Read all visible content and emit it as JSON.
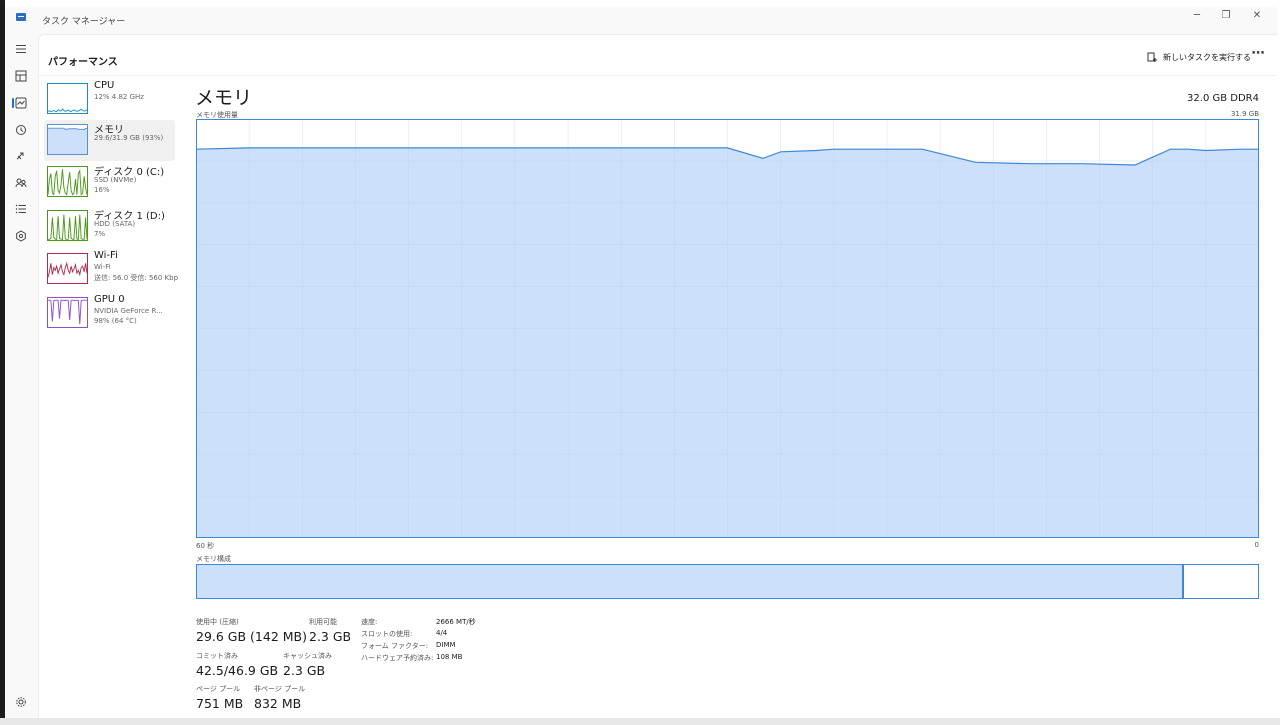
{
  "window": {
    "title": "タスク マネージャー",
    "controls": [
      "minimize-icon",
      "restore-icon",
      "close-icon"
    ]
  },
  "header": {
    "page_title": "パフォーマンス",
    "new_task_label": "新しいタスクを実行する",
    "more_label": "⋯"
  },
  "nav": {
    "items": [
      "hamburger-icon",
      "processes-icon",
      "performance-icon",
      "app-history-icon",
      "startup-apps-icon",
      "users-icon",
      "details-icon",
      "services-icon"
    ],
    "settings": "gear-icon",
    "active": "performance-icon"
  },
  "sidebar": {
    "items": [
      {
        "name": "CPU",
        "sub1": "12% 4.82 GHz",
        "sub2": "",
        "sub3": "",
        "color": "#1c8fbb",
        "fill": "#ffffff",
        "values": [
          6,
          8,
          5,
          7,
          9,
          6,
          5,
          12,
          8,
          7,
          14,
          9,
          6,
          8,
          10,
          7,
          5,
          9,
          11,
          8,
          6,
          7,
          10,
          14,
          9,
          7,
          8,
          12
        ],
        "selected": false
      },
      {
        "name": "メモリ",
        "sub1": "29.6/31.9 GB (93%)",
        "sub2": "",
        "sub3": "",
        "color": "#5a8fd4",
        "fill": "#cce0fa",
        "values": [
          91,
          92,
          92,
          92,
          92,
          92,
          92,
          92,
          92,
          92,
          92,
          92,
          87,
          89,
          89,
          90,
          90,
          90,
          90,
          90,
          90,
          88,
          88,
          88,
          88,
          87,
          91,
          91
        ],
        "selected": true
      },
      {
        "name": "ディスク 0 (C:)",
        "sub1": "SSD (NVMe)",
        "sub2": "16%",
        "sub3": "",
        "color": "#4d9a1a",
        "fill": "#ffffff",
        "values": [
          5,
          60,
          80,
          10,
          5,
          70,
          90,
          20,
          10,
          40,
          95,
          30,
          10,
          5,
          50,
          85,
          20,
          5,
          10,
          60,
          5,
          80,
          90,
          5,
          10,
          70,
          30,
          5
        ],
        "selected": false
      },
      {
        "name": "ディスク 1 (D:)",
        "sub1": "HDD (SATA)",
        "sub2": "7%",
        "sub3": "",
        "color": "#4d9a1a",
        "fill": "#ffffff",
        "values": [
          2,
          3,
          5,
          80,
          10,
          3,
          2,
          85,
          5,
          3,
          2,
          90,
          4,
          2,
          3,
          80,
          6,
          3,
          2,
          85,
          3,
          2,
          90,
          5,
          3,
          2,
          80,
          3
        ],
        "selected": false
      },
      {
        "name": "Wi-Fi",
        "sub1": "Wi-Fi",
        "sub2": "送信: 56.0 受信: 560 Kbp",
        "sub3": "",
        "color": "#b5294f",
        "fill": "#ffffff",
        "values": [
          20,
          40,
          70,
          30,
          55,
          45,
          60,
          35,
          50,
          65,
          40,
          30,
          55,
          70,
          45,
          35,
          60,
          40,
          50,
          65,
          35,
          45,
          30,
          55,
          60,
          40,
          70,
          35
        ],
        "selected": false
      },
      {
        "name": "GPU 0",
        "sub1": "NVIDIA GeForce R...",
        "sub2": "98% (64 °C)",
        "sub3": "",
        "color": "#8f4fc8",
        "fill": "#ffffff",
        "values": [
          95,
          96,
          95,
          20,
          94,
          95,
          96,
          95,
          30,
          96,
          95,
          95,
          94,
          96,
          95,
          25,
          95,
          96,
          95,
          94,
          96,
          95,
          10,
          94,
          96,
          95,
          95,
          96
        ],
        "selected": false
      }
    ]
  },
  "main": {
    "title": "メモリ",
    "spec": "32.0 GB DDR4",
    "chart_label": "メモリ使用量",
    "chart_max": "31.9 GB",
    "axis_left": "60 秒",
    "axis_right": "0",
    "composition_label": "メモリ構成"
  },
  "chart_data": {
    "type": "area",
    "title": "メモリ使用量",
    "xlabel": "",
    "ylabel": "",
    "x": [
      60,
      57,
      54,
      51,
      48,
      45,
      42,
      39,
      36,
      33,
      30,
      28,
      27,
      25,
      24,
      22,
      19,
      16,
      13,
      10,
      7,
      5,
      4,
      3,
      1,
      0
    ],
    "y": [
      29.6,
      29.7,
      29.7,
      29.7,
      29.7,
      29.7,
      29.7,
      29.7,
      29.7,
      29.7,
      29.7,
      28.9,
      29.4,
      29.5,
      29.6,
      29.6,
      29.6,
      28.6,
      28.5,
      28.5,
      28.4,
      29.6,
      29.6,
      29.5,
      29.6,
      29.6
    ],
    "ylim": [
      0,
      31.9
    ],
    "xlim": [
      60,
      0
    ],
    "grid": true,
    "series_color": "#3f86d8",
    "fill_color": "#cce0fa",
    "composition_used_fraction": 0.93
  },
  "stats": {
    "in_use_label": "使用中 (圧縮)",
    "in_use_value": "29.6 GB (142 MB)",
    "available_label": "利用可能",
    "available_value": "2.3 GB",
    "committed_label": "コミット済み",
    "committed_value": "42.5/46.9 GB",
    "cached_label": "キャッシュ済み",
    "cached_value": "2.3 GB",
    "paged_label": "ページ プール",
    "paged_value": "751 MB",
    "nonpaged_label": "非ページ プール",
    "nonpaged_value": "832 MB"
  },
  "specs": {
    "speed_label": "速度:",
    "speed_value": "2666 MT/秒",
    "slots_label": "スロットの使用:",
    "slots_value": "4/4",
    "form_label": "フォーム ファクター:",
    "form_value": "DIMM",
    "reserved_label": "ハードウェア予約済み:",
    "reserved_value": "108 MB"
  }
}
